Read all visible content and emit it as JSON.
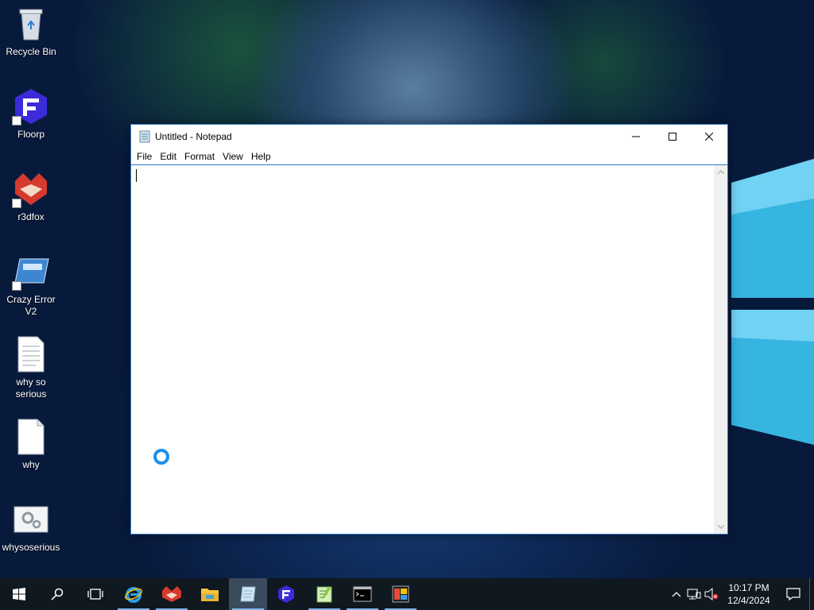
{
  "desktop": {
    "icons": [
      {
        "label": "Recycle Bin",
        "icon": "recycle-bin-icon"
      },
      {
        "label": "Floorp",
        "icon": "floorp-icon"
      },
      {
        "label": "r3dfox",
        "icon": "r3dfox-icon"
      },
      {
        "label": "Crazy Error V2",
        "icon": "crazy-error-icon"
      },
      {
        "label": "why so serious",
        "icon": "text-file-icon"
      },
      {
        "label": "why",
        "icon": "blank-file-icon"
      },
      {
        "label": "whysoserious",
        "icon": "settings-file-icon"
      }
    ]
  },
  "notepad": {
    "title": "Untitled - Notepad",
    "menu": [
      "File",
      "Edit",
      "Format",
      "View",
      "Help"
    ],
    "content": ""
  },
  "taskbar": {
    "buttons": [
      {
        "name": "start-button",
        "icon": "windows-icon"
      },
      {
        "name": "search-button",
        "icon": "search-icon"
      },
      {
        "name": "task-view-button",
        "icon": "task-view-icon"
      },
      {
        "name": "taskbar-internet-explorer",
        "icon": "internet-explorer-icon"
      },
      {
        "name": "taskbar-r3dfox",
        "icon": "r3dfox-icon"
      },
      {
        "name": "taskbar-file-explorer",
        "icon": "folder-icon"
      },
      {
        "name": "taskbar-notepad",
        "icon": "notepad-icon"
      },
      {
        "name": "taskbar-floorp",
        "icon": "floorp-icon"
      },
      {
        "name": "taskbar-notepadplusplus",
        "icon": "notepadplusplus-icon"
      },
      {
        "name": "taskbar-command-prompt",
        "icon": "cmd-icon"
      },
      {
        "name": "taskbar-app",
        "icon": "app-icon"
      }
    ],
    "clock": {
      "time": "10:17 PM",
      "date": "12/4/2024"
    }
  },
  "colors": {
    "accent": "#2b79c8",
    "taskbar": "#101820",
    "busy_cursor": "#1e90e8"
  }
}
